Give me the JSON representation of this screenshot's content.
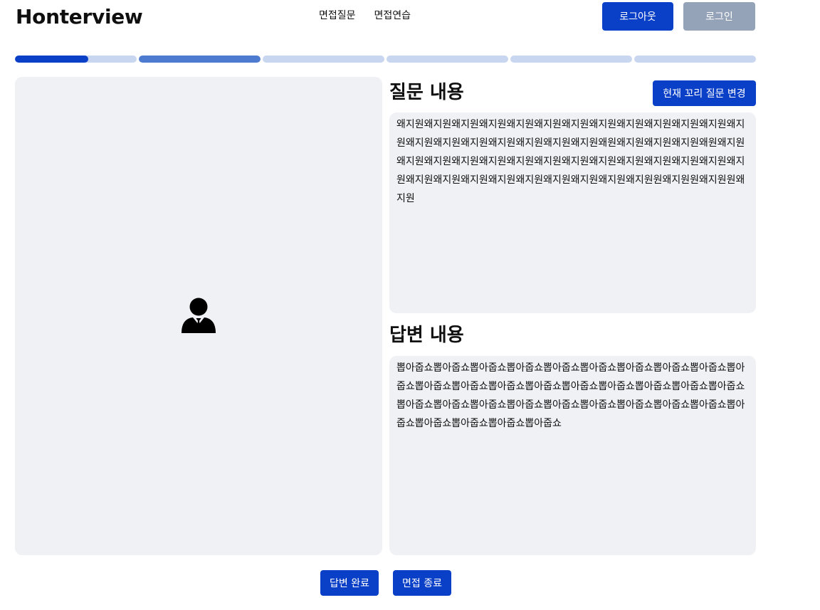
{
  "header": {
    "logo": "Honterview",
    "nav": [
      {
        "label": "면접질문"
      },
      {
        "label": "면접연습"
      }
    ],
    "logout_label": "로그아웃",
    "login_label": "로그인"
  },
  "progress": {
    "segments": [
      {
        "fill": 0.6,
        "color": "#0a40c7"
      },
      {
        "fill": 1.0,
        "color": "#4d7bd0"
      },
      {
        "fill": 0.0,
        "color": "#c9d6f0"
      },
      {
        "fill": 0.0,
        "color": "#c9d6f0"
      },
      {
        "fill": 0.0,
        "color": "#c9d6f0"
      },
      {
        "fill": 0.0,
        "color": "#c9d6f0"
      }
    ]
  },
  "video": {
    "avatar_icon": "businessman-icon"
  },
  "question": {
    "title": "질문 내용",
    "change_button_label": "현재 꼬리 질문 변경",
    "text": "왜지원왜지원왜지원왜지원왜지원왜지원왜지원왜지원왜지원왜지원왜지원왜지원왜지원왜지원왜지원왜지원왜지원왜지원왜지원왜지원왜원왜지원왜지원왜지원왜원왜지원왜지원왜지원왜지원왜지원왜지원왜지원왜지원왜지원왜지원왜지원왜지원왜지원왜지원왜지원왜지원왜지원왜지원왜지원왜지원왜지원왜지원왜지원원왜지원원왜지원원왜지원"
  },
  "answer": {
    "title": "답변 내용",
    "text": "뽑아줍쇼뽑아줍쇼뽑아줍쇼뽑아줍쇼뽑아줍쇼뽑아줍쇼뽑아줍쇼뽑아줍쇼뽑아줍쇼뽑아줍쇼뽑아줍쇼뽑아줍쇼뽑아줍쇼뽑아줍쇼뽑아줍쇼뽑아줍쇼뽑아줍쇼뽑아줍쇼뽑아줍쇼뽑아줍쇼뽑아줍쇼뽑아줍쇼뽑아줍쇼뽑아줍쇼뽑아줍쇼뽑아줍쇼뽑아줍쇼뽑아줍쇼뽑아줍쇼뽑아줍쇼뽑아줍쇼뽑아줍쇼뽑아줍쇼"
  },
  "footer": {
    "answer_done_label": "답변 완료",
    "end_interview_label": "면접 종료"
  }
}
